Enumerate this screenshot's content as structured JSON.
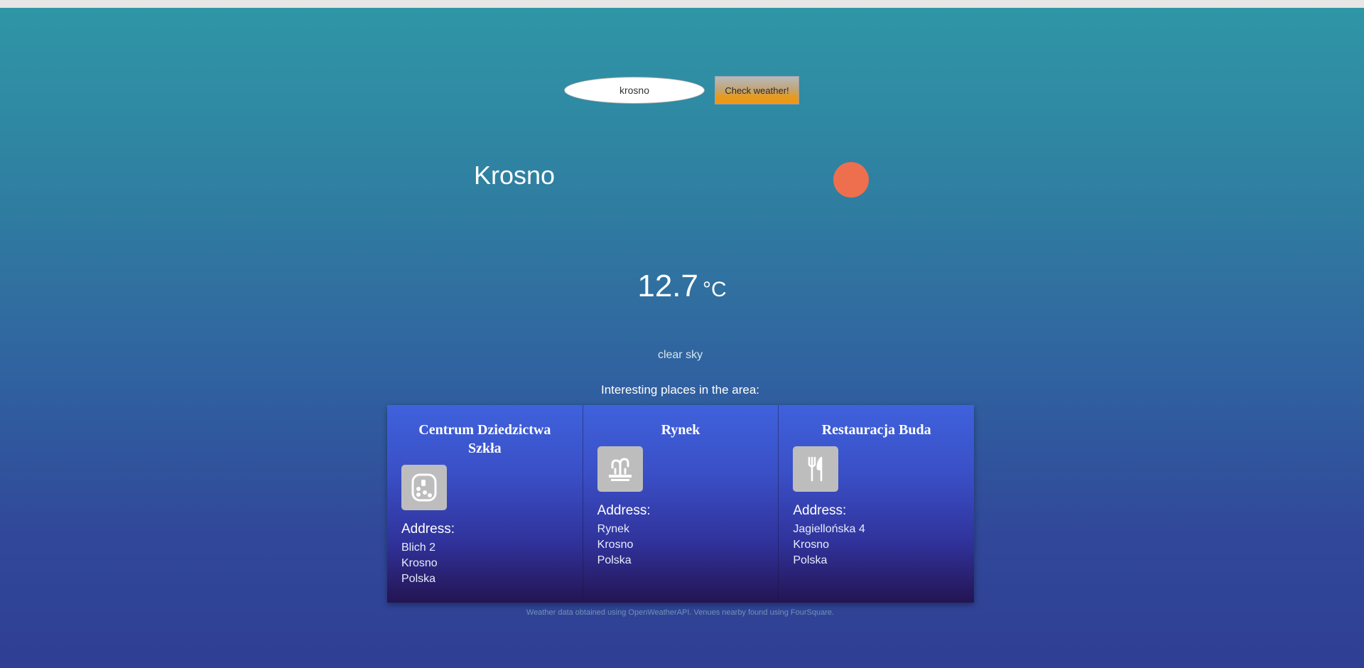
{
  "search": {
    "value": "krosno",
    "button_label": "Check weather!"
  },
  "weather": {
    "city": "Krosno",
    "temperature": "12.7",
    "unit": "°C",
    "description": "clear sky",
    "status_color": "#ee6f4d"
  },
  "places": {
    "heading": "Interesting places in the area:",
    "items": [
      {
        "name": "Centrum Dziedzictwa Szkła",
        "icon": "museum-icon",
        "address_label": "Address:",
        "address": [
          "Blich 2",
          "Krosno",
          "Polska"
        ]
      },
      {
        "name": "Rynek",
        "icon": "fountain-icon",
        "address_label": "Address:",
        "address": [
          "Rynek",
          "Krosno",
          "Polska"
        ]
      },
      {
        "name": "Restauracja Buda",
        "icon": "restaurant-icon",
        "address_label": "Address:",
        "address": [
          "Jagiellońska 4",
          "Krosno",
          "Polska"
        ]
      }
    ]
  },
  "footer": {
    "text": "Weather data obtained using OpenWeatherAPI. Venues nearby found using FourSquare."
  },
  "colors": {
    "card_gradient_top": "#3f62dc",
    "card_gradient_bottom": "#241452",
    "button_accent": "#f09712"
  }
}
